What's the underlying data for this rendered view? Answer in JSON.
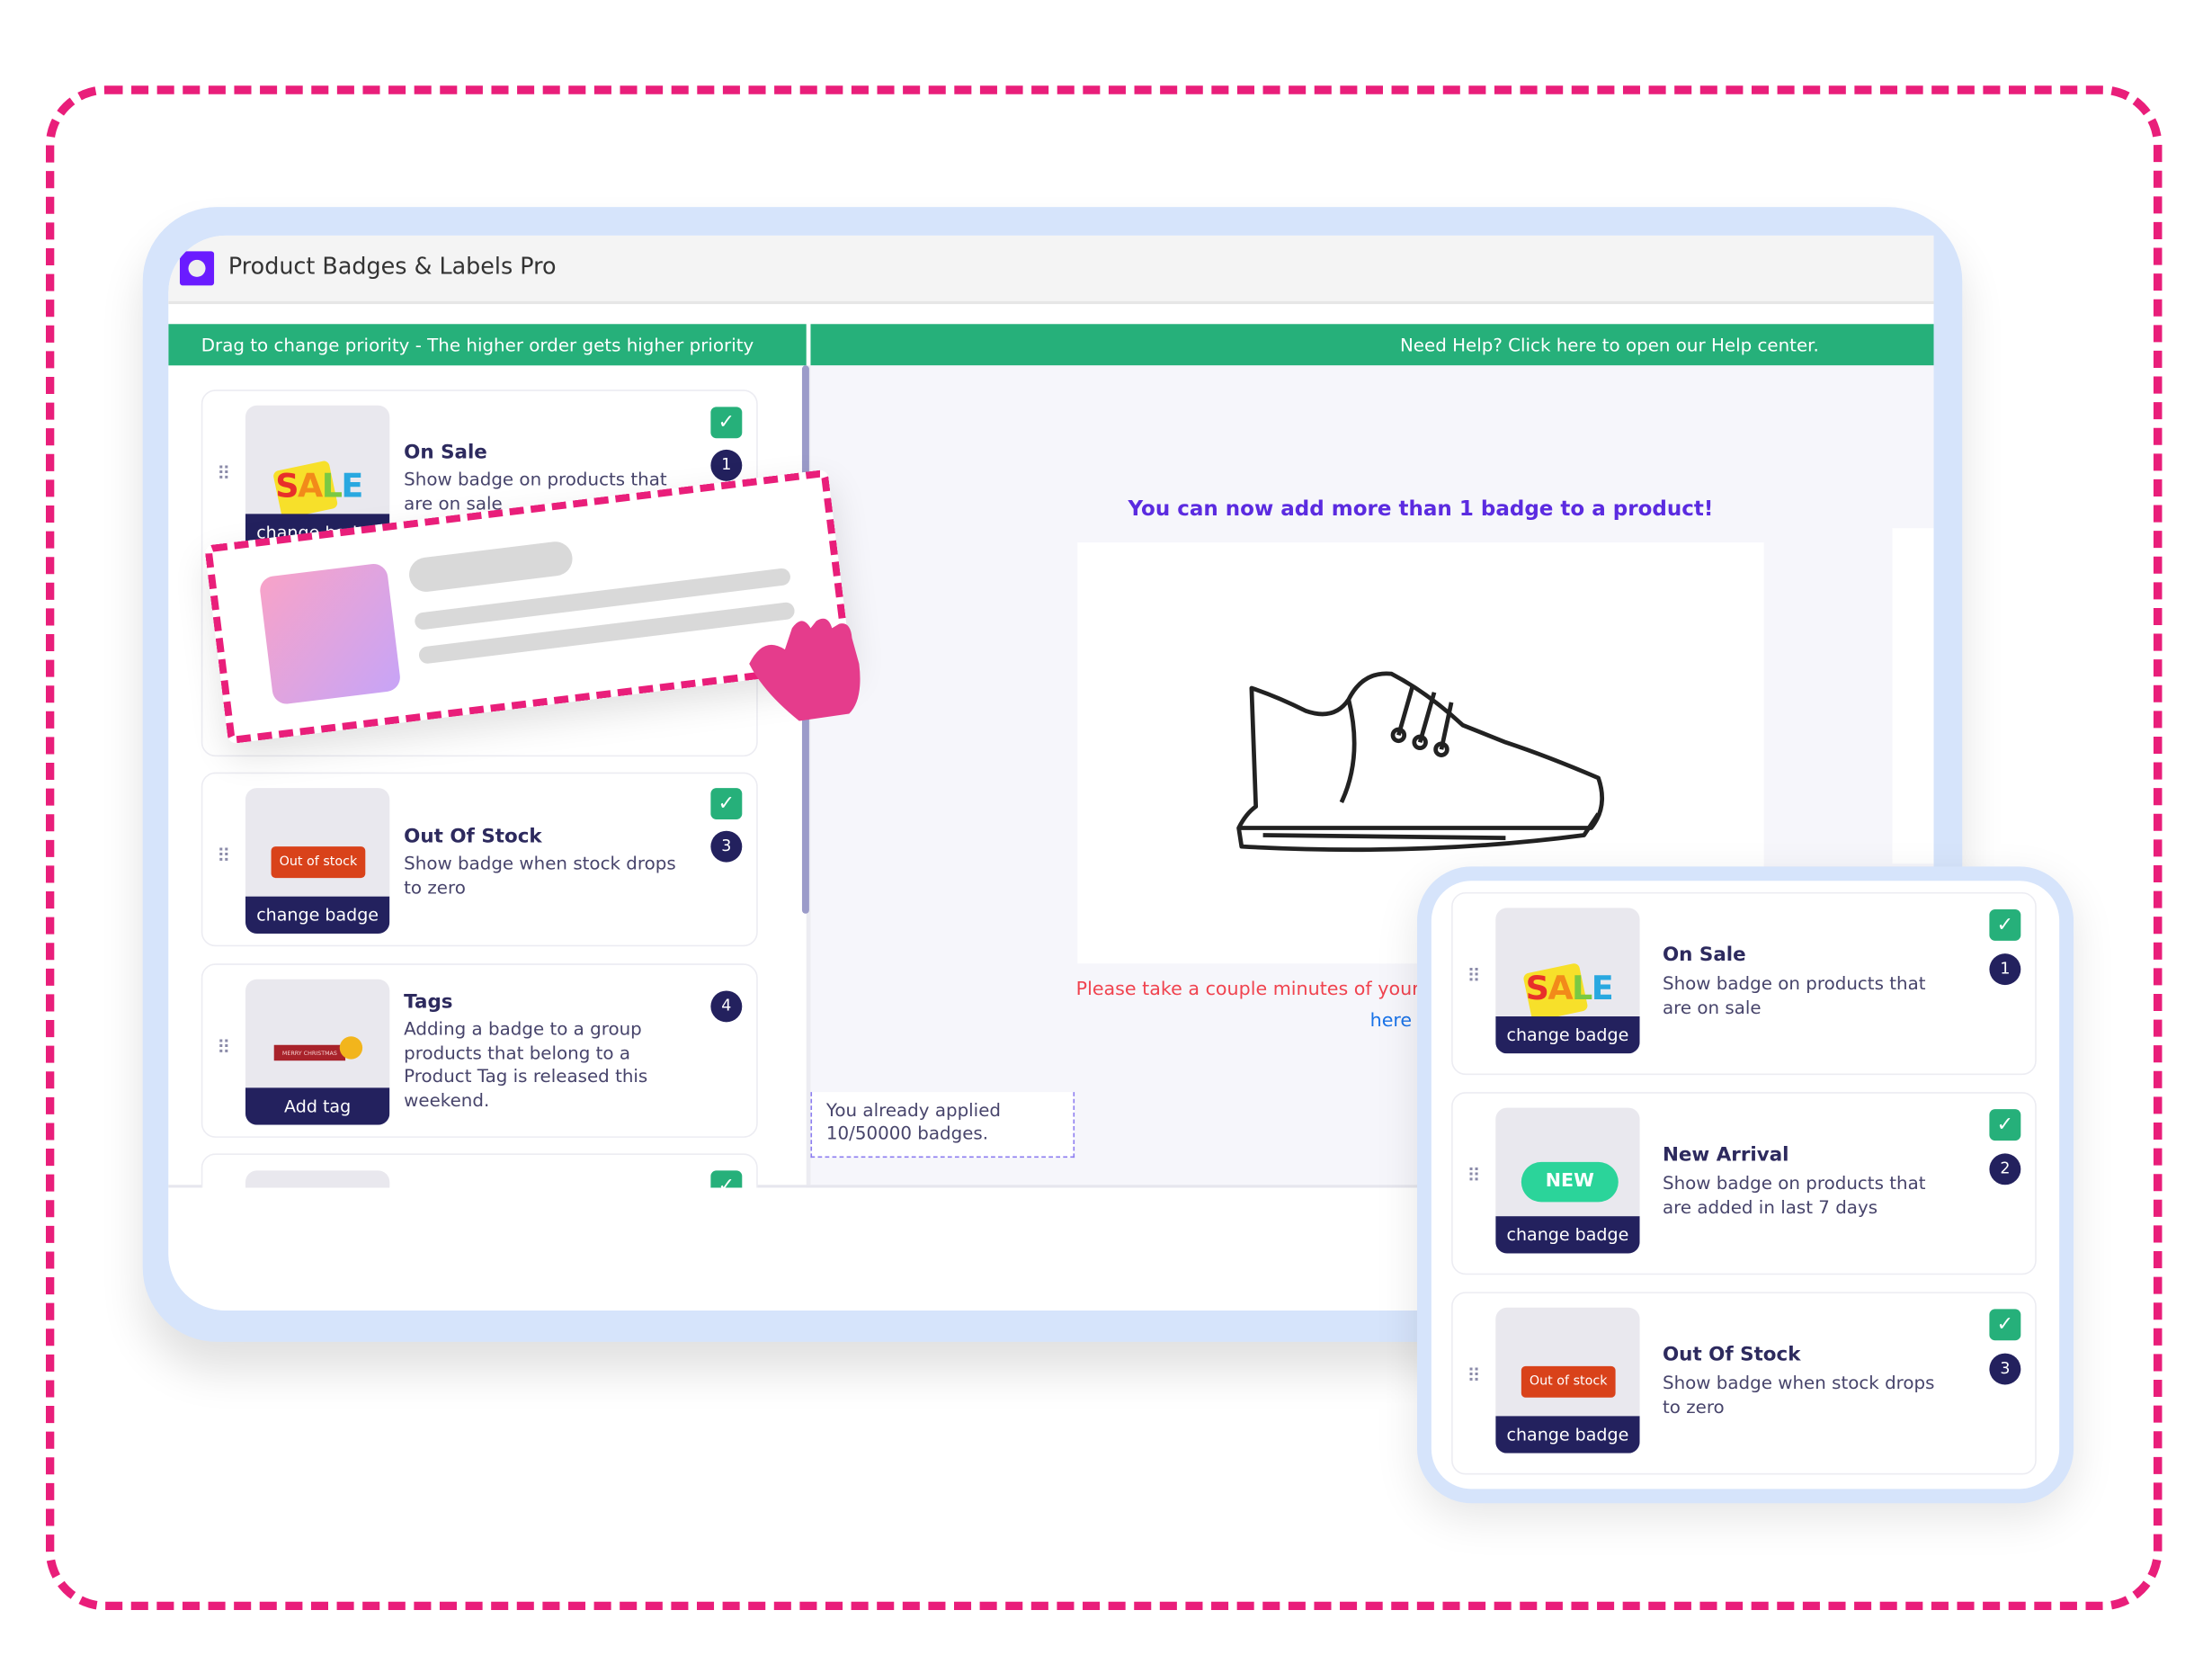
{
  "app": {
    "title": "Product Badges & Labels Pro"
  },
  "banner": {
    "left": "Drag to change priority - The higher order gets higher priority",
    "right": "Need Help? Click here to open our Help center."
  },
  "main": {
    "headline": "You can now add more than 1 badge to a product!",
    "review_text": "Please take a couple minutes of your",
    "review_link": "here",
    "applied": "You already applied 10/50000 badges."
  },
  "list": [
    {
      "title": "On Sale",
      "desc": "Show badge on products that are on sale",
      "button": "change badge",
      "badge": "SALE",
      "priority": "1",
      "enabled": true
    },
    {
      "title": "Out Of Stock",
      "desc": "Show badge when stock drops to zero",
      "button": "change badge",
      "badge": "Out of stock",
      "priority": "3",
      "enabled": true
    },
    {
      "title": "Tags",
      "desc": "Adding a badge to a group products that belong to a Product Tag is released this weekend.",
      "button": "Add tag",
      "badge": "MERRY CHRISTMAS",
      "priority": "4",
      "enabled": false
    }
  ],
  "floating": [
    {
      "title": "On Sale",
      "desc": "Show badge on products that are on sale",
      "button": "change badge",
      "badge": "SALE",
      "priority": "1",
      "enabled": true
    },
    {
      "title": "New Arrival",
      "desc": "Show badge on products that are added in last 7 days",
      "button": "change badge",
      "badge": "NEW",
      "priority": "2",
      "enabled": true
    },
    {
      "title": "Out Of Stock",
      "desc": "Show badge when stock drops to zero",
      "button": "change badge",
      "badge": "Out of stock",
      "priority": "3",
      "enabled": true
    }
  ],
  "colors": {
    "accent_pink": "#e91e7a",
    "green": "#26b07a",
    "navy": "#23215e",
    "purple": "#6a1bff",
    "headline": "#5b2be0",
    "error": "#f0434f",
    "link": "#1a73e8"
  },
  "icons": {
    "check": "check-icon",
    "grip": "drag-handle-icon",
    "hand": "hand-pointer-icon",
    "shoe": "sneaker-illustration"
  }
}
